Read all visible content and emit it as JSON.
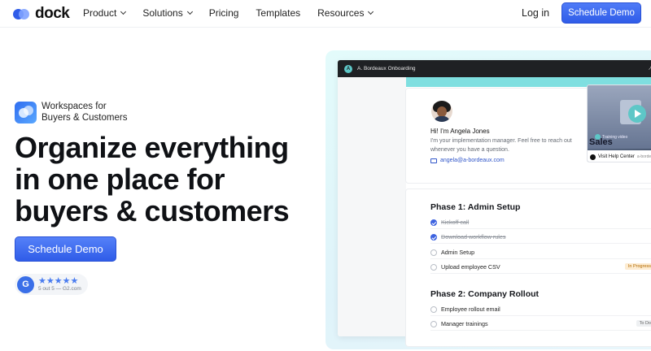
{
  "nav": {
    "logo": "dock",
    "links": [
      {
        "label": "Product",
        "dropdown": true
      },
      {
        "label": "Solutions",
        "dropdown": true
      },
      {
        "label": "Pricing",
        "dropdown": false
      },
      {
        "label": "Templates",
        "dropdown": false
      },
      {
        "label": "Resources",
        "dropdown": true
      }
    ],
    "login": "Log in",
    "cta": "Schedule Demo"
  },
  "hero": {
    "badge_line1": "Workspaces for",
    "badge_line2": "Buyers & Customers",
    "title_line1": "Organize everything",
    "title_line2": "in one place for",
    "title_line3": "buyers & customers",
    "cta": "Schedule Demo",
    "rating": {
      "icon": "G",
      "stars": "★★★★★",
      "text": "5 out 5 — G2.com"
    }
  },
  "mockup": {
    "workspace_initial": "A",
    "workspace_title": "A. Bordeaux Onboarding",
    "intro": {
      "name": "Hi! I'm Angela Jones",
      "description": "I'm your implementation manager. Feel free to reach out whenever you have a question.",
      "email": "angela@a-bordeaux.com"
    },
    "video": {
      "tag": "Training video",
      "title": "Sales",
      "help": "Visit Help Center",
      "help_sub": "a-borde"
    },
    "phase1": {
      "title": "Phase 1: Admin Setup",
      "tasks": [
        {
          "label": "Kickoff call",
          "done": true,
          "status": ""
        },
        {
          "label": "Download workflow rules",
          "done": true,
          "status": ""
        },
        {
          "label": "Admin Setup",
          "done": false,
          "status": ""
        },
        {
          "label": "Upload employee CSV",
          "done": false,
          "status": "In Progress"
        }
      ]
    },
    "phase2": {
      "title": "Phase 2: Company Rollout",
      "tasks": [
        {
          "label": "Employee rollout email",
          "done": false,
          "status": ""
        },
        {
          "label": "Manager trainings",
          "done": false,
          "status": "To Do"
        }
      ]
    }
  },
  "colors": {
    "accent": "#2f5ce8",
    "teal": "#7fdfe0",
    "dark_bar": "#1f2124"
  }
}
